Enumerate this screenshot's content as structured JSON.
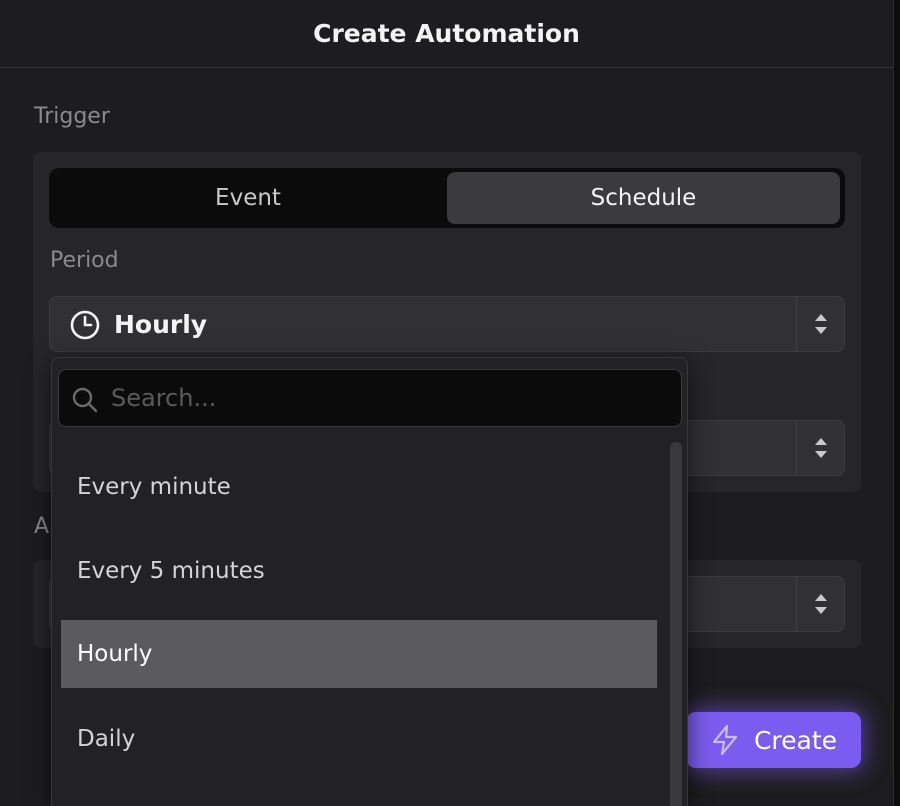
{
  "modal": {
    "title": "Create Automation",
    "trigger_label": "Trigger",
    "action_label": "A",
    "tabs": [
      {
        "label": "Event",
        "selected": false
      },
      {
        "label": "Schedule",
        "selected": true
      }
    ],
    "period_label": "Period",
    "period_value": "Hourly",
    "create_label": "Create"
  },
  "dropdown": {
    "search_placeholder": "Search...",
    "options": [
      {
        "label": "Every minute",
        "selected": false
      },
      {
        "label": "Every 5 minutes",
        "selected": false
      },
      {
        "label": "Hourly",
        "selected": true
      },
      {
        "label": "Daily",
        "selected": false
      }
    ]
  },
  "colors": {
    "accent": "#7b5cf0",
    "selected_option": "#5b5b5d",
    "background": "#1d1d1f"
  }
}
